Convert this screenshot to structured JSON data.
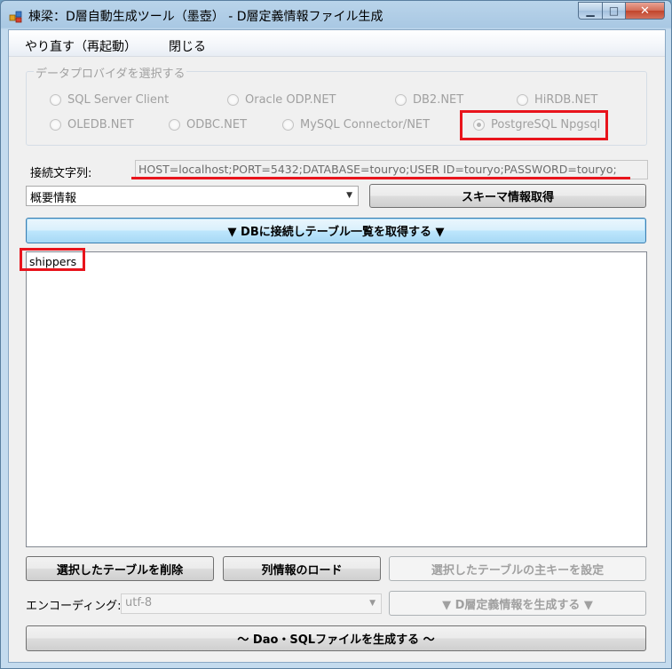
{
  "window": {
    "title": "棟梁：D層自動生成ツール（墨壺） - D層定義情報ファイル生成",
    "minimize_glyph": "▁",
    "maximize_glyph": "□",
    "close_glyph": "✕"
  },
  "menu": {
    "items": [
      "やり直す（再起動）",
      "閉じる"
    ]
  },
  "provider": {
    "legend": "データプロバイダを選択する",
    "options": [
      {
        "label": "SQL Server Client",
        "selected": false
      },
      {
        "label": "Oracle ODP.NET",
        "selected": false
      },
      {
        "label": "DB2.NET",
        "selected": false
      },
      {
        "label": "HiRDB.NET",
        "selected": false
      },
      {
        "label": "OLEDB.NET",
        "selected": false
      },
      {
        "label": "ODBC.NET",
        "selected": false
      },
      {
        "label": "MySQL Connector/NET",
        "selected": false
      },
      {
        "label": "PostgreSQL Npgsql",
        "selected": true
      }
    ]
  },
  "connection": {
    "label": "接続文字列:",
    "value": "HOST=localhost;PORT=5432;DATABASE=touryo;USER ID=touryo;PASSWORD=touryo;"
  },
  "schema": {
    "selected": "概要情報",
    "button": "スキーマ情報取得"
  },
  "connect_button": "▼ DBに接続しテーブル一覧を取得する ▼",
  "tables": [
    "shippers"
  ],
  "actions": {
    "delete": "選択したテーブルを削除",
    "load_columns": "列情報のロード",
    "set_primary_key": "選択したテーブルの主キーを設定"
  },
  "encoding": {
    "label": "エンコーディング:",
    "value": "utf-8",
    "generate_button": "▼ D層定義情報を生成する ▼"
  },
  "generate_dao_button": "～ Dao・SQLファイルを生成する ～",
  "colors": {
    "highlight": "#e8141c",
    "focus_border": "#3c7fb1"
  }
}
